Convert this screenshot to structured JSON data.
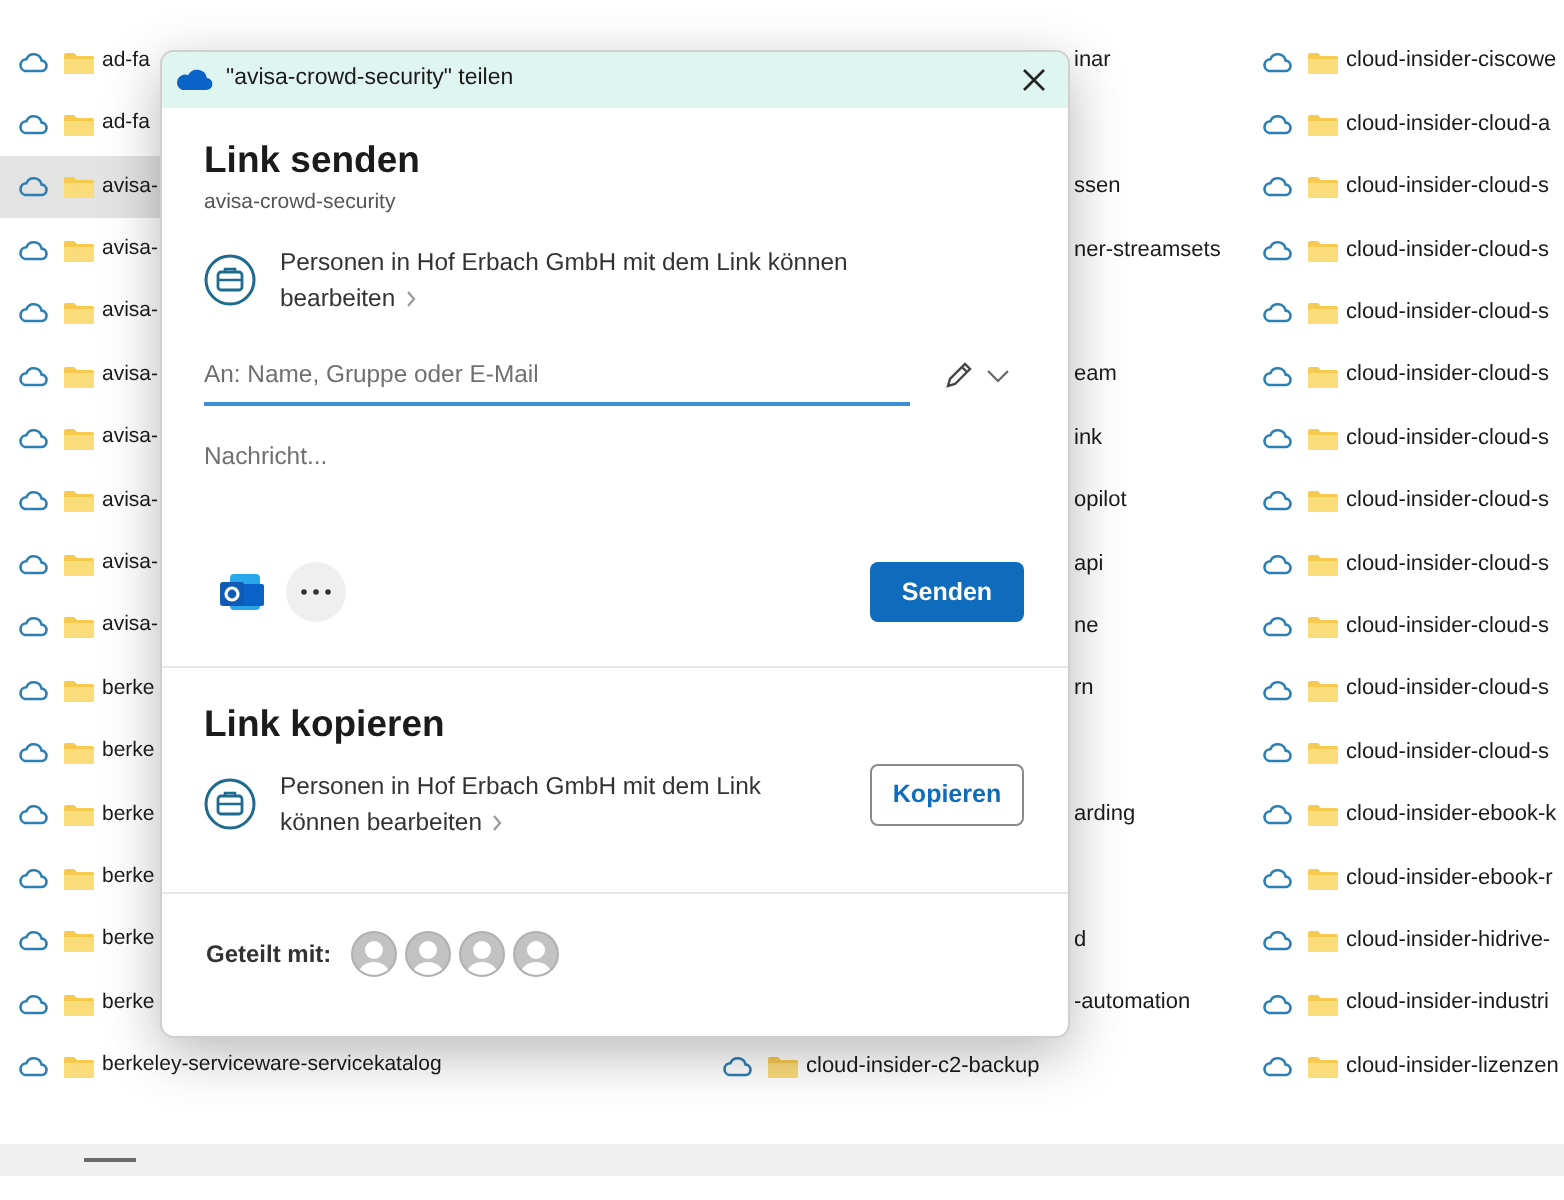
{
  "explorer": {
    "columns": [
      {
        "rows": [
          {
            "kind": "entry",
            "name": "ad-fa",
            "selected": false
          },
          {
            "kind": "entry",
            "name": "ad-fa",
            "selected": false
          },
          {
            "kind": "entry",
            "name": "avisa-",
            "selected": true
          },
          {
            "kind": "entry",
            "name": "avisa-",
            "selected": false
          },
          {
            "kind": "entry",
            "name": "avisa-",
            "selected": false
          },
          {
            "kind": "entry",
            "name": "avisa-",
            "selected": false
          },
          {
            "kind": "entry",
            "name": "avisa-",
            "selected": false
          },
          {
            "kind": "entry",
            "name": "avisa-",
            "selected": false
          },
          {
            "kind": "entry",
            "name": "avisa-",
            "selected": false
          },
          {
            "kind": "entry",
            "name": "avisa-",
            "selected": false
          },
          {
            "kind": "entry",
            "name": "berke",
            "selected": false
          },
          {
            "kind": "entry",
            "name": "berke",
            "selected": false
          },
          {
            "kind": "entry",
            "name": "berke",
            "selected": false
          },
          {
            "kind": "entry",
            "name": "berke",
            "selected": false
          },
          {
            "kind": "entry",
            "name": "berke",
            "selected": false
          },
          {
            "kind": "entry",
            "name": "berke",
            "selected": false
          },
          {
            "kind": "entry",
            "name": "berkeley-serviceware-servicekatalog",
            "selected": false
          }
        ]
      },
      {
        "rows": [
          {
            "kind": "fragment",
            "name": "inar"
          },
          {
            "kind": "empty"
          },
          {
            "kind": "fragment",
            "name": "ssen"
          },
          {
            "kind": "fragment",
            "name": "ner-streamsets"
          },
          {
            "kind": "empty"
          },
          {
            "kind": "fragment",
            "name": "eam"
          },
          {
            "kind": "fragment",
            "name": "ink"
          },
          {
            "kind": "fragment",
            "name": "opilot"
          },
          {
            "kind": "fragment",
            "name": "api"
          },
          {
            "kind": "fragment",
            "name": "ne"
          },
          {
            "kind": "fragment",
            "name": "rn"
          },
          {
            "kind": "empty"
          },
          {
            "kind": "fragment",
            "name": "arding"
          },
          {
            "kind": "empty"
          },
          {
            "kind": "fragment",
            "name": "d"
          },
          {
            "kind": "fragment",
            "name": "-automation"
          },
          {
            "kind": "entry",
            "name": "cloud-insider-c2-backup",
            "selected": false
          }
        ]
      },
      {
        "rows": [
          {
            "kind": "entry",
            "name": "cloud-insider-ciscowe",
            "selected": false
          },
          {
            "kind": "entry",
            "name": "cloud-insider-cloud-a",
            "selected": false
          },
          {
            "kind": "entry",
            "name": "cloud-insider-cloud-s",
            "selected": false
          },
          {
            "kind": "entry",
            "name": "cloud-insider-cloud-s",
            "selected": false
          },
          {
            "kind": "entry",
            "name": "cloud-insider-cloud-s",
            "selected": false
          },
          {
            "kind": "entry",
            "name": "cloud-insider-cloud-s",
            "selected": false
          },
          {
            "kind": "entry",
            "name": "cloud-insider-cloud-s",
            "selected": false
          },
          {
            "kind": "entry",
            "name": "cloud-insider-cloud-s",
            "selected": false
          },
          {
            "kind": "entry",
            "name": "cloud-insider-cloud-s",
            "selected": false
          },
          {
            "kind": "entry",
            "name": "cloud-insider-cloud-s",
            "selected": false
          },
          {
            "kind": "entry",
            "name": "cloud-insider-cloud-s",
            "selected": false
          },
          {
            "kind": "entry",
            "name": "cloud-insider-cloud-s",
            "selected": false
          },
          {
            "kind": "entry",
            "name": "cloud-insider-ebook-k",
            "selected": false
          },
          {
            "kind": "entry",
            "name": "cloud-insider-ebook-r",
            "selected": false
          },
          {
            "kind": "entry",
            "name": "cloud-insider-hidrive-",
            "selected": false
          },
          {
            "kind": "entry",
            "name": "cloud-insider-industri",
            "selected": false
          },
          {
            "kind": "entry",
            "name": "cloud-insider-lizenzen",
            "selected": false
          }
        ]
      }
    ]
  },
  "dialog": {
    "title": "\"avisa-crowd-security\" teilen",
    "send": {
      "heading": "Link senden",
      "item_name": "avisa-crowd-security",
      "permission": "Personen in Hof Erbach GmbH mit dem Link können bearbeiten",
      "to_field": {
        "placeholder": "An: Name, Gruppe oder E-Mail"
      },
      "message": {
        "placeholder": "Nachricht..."
      },
      "button": "Senden"
    },
    "copy": {
      "heading": "Link kopieren",
      "permission": "Personen in Hof Erbach GmbH mit dem Link können bearbeiten",
      "button": "Kopieren"
    },
    "shared_with": {
      "label": "Geteilt mit:",
      "avatars": [
        {
          "kind": "person"
        },
        {
          "kind": "person"
        },
        {
          "kind": "person"
        },
        {
          "kind": "person"
        }
      ]
    }
  }
}
